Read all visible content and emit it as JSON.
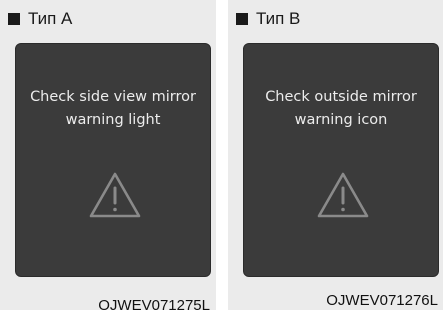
{
  "panels": [
    {
      "label": "Тип A",
      "message_line1": "Check side view mirror",
      "message_line2": "warning light",
      "icon": "warning-triangle-icon",
      "code": "OJWEV071275L"
    },
    {
      "label": "Тип B",
      "message_line1": "Check outside mirror",
      "message_line2": "warning icon",
      "icon": "warning-triangle-icon",
      "code": "OJWEV071276L"
    }
  ],
  "colors": {
    "panel_bg": "#ebebeb",
    "screen_bg": "#3b3b3b",
    "screen_text": "#ececec",
    "icon_stroke": "#8a8a8a"
  }
}
